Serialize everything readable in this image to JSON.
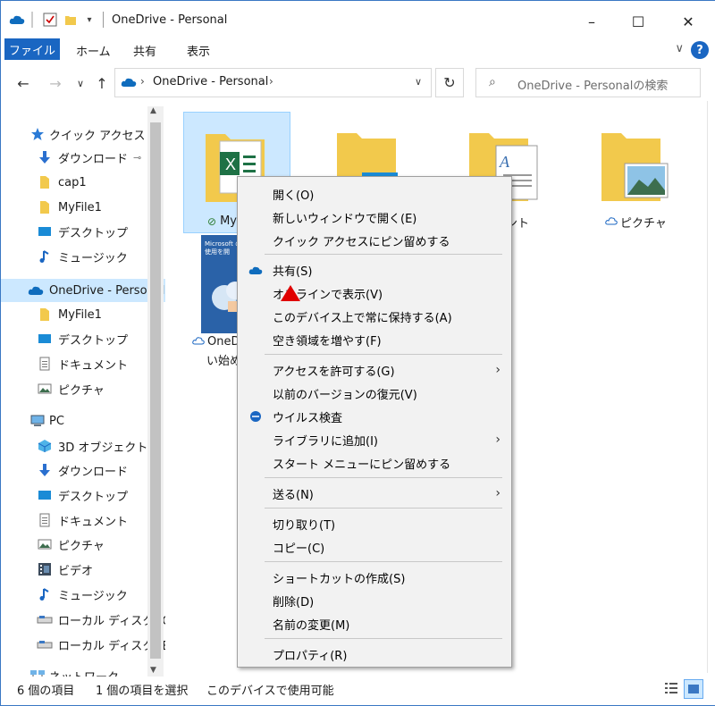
{
  "window": {
    "title": "OneDrive - Personal",
    "controls": {
      "minimize": "–",
      "maximize": "☐",
      "close": "✕"
    }
  },
  "ribbon": {
    "tabs": [
      "ファイル",
      "ホーム",
      "共有",
      "表示"
    ],
    "help": "?"
  },
  "address": {
    "path": "OneDrive - Personal",
    "search_placeholder": "OneDrive - Personalの検索"
  },
  "sidebar": {
    "items": [
      {
        "label": "クイック アクセス",
        "icon": "star-icon"
      },
      {
        "label": "ダウンロード",
        "icon": "download-icon"
      },
      {
        "label": "cap1",
        "icon": "folder-icon"
      },
      {
        "label": "MyFile1",
        "icon": "folder-icon"
      },
      {
        "label": "デスクトップ",
        "icon": "desktop-icon"
      },
      {
        "label": "ミュージック",
        "icon": "music-icon"
      },
      {
        "label": "OneDrive - Personal",
        "icon": "onedrive-icon"
      },
      {
        "label": "MyFile1",
        "icon": "folder-icon"
      },
      {
        "label": "デスクトップ",
        "icon": "desktop-icon"
      },
      {
        "label": "ドキュメント",
        "icon": "document-icon"
      },
      {
        "label": "ピクチャ",
        "icon": "pictures-icon"
      },
      {
        "label": "PC",
        "icon": "pc-icon"
      },
      {
        "label": "3D オブジェクト",
        "icon": "3d-objects-icon"
      },
      {
        "label": "ダウンロード",
        "icon": "download-icon"
      },
      {
        "label": "デスクトップ",
        "icon": "desktop-icon"
      },
      {
        "label": "ドキュメント",
        "icon": "document-icon"
      },
      {
        "label": "ピクチャ",
        "icon": "pictures-icon"
      },
      {
        "label": "ビデオ",
        "icon": "video-icon"
      },
      {
        "label": "ミュージック",
        "icon": "music-icon"
      },
      {
        "label": "ローカル ディスク (C",
        "icon": "drive-icon"
      },
      {
        "label": "ローカル ディスク (E",
        "icon": "drive-icon"
      },
      {
        "label": "ネットワーク",
        "icon": "network-icon"
      }
    ]
  },
  "content": {
    "items": [
      {
        "label": "My",
        "icon": "excel-folder-icon"
      },
      {
        "label": "",
        "icon": "desktop-folder-icon"
      },
      {
        "label": "メント",
        "icon": "documents-folder-icon"
      },
      {
        "label": "ピクチャ",
        "icon": "pictures-folder-icon"
      },
      {
        "label": "OneD",
        "label2": "い始め",
        "icon": "pdf-thumbnail-icon",
        "thumb_text": "Microsoft の使用を開"
      }
    ]
  },
  "context_menu": {
    "items": [
      "開く(O)",
      "新しいウィンドウで開く(E)",
      "クイック アクセスにピン留めする",
      "共有(S)",
      "オンラインで表示(V)",
      "このデバイス上で常に保持する(A)",
      "空き領域を増やす(F)",
      "アクセスを許可する(G)",
      "以前のバージョンの復元(V)",
      "ウイルス検査",
      "ライブラリに追加(I)",
      "スタート メニューにピン留めする",
      "送る(N)",
      "切り取り(T)",
      "コピー(C)",
      "ショートカットの作成(S)",
      "削除(D)",
      "名前の変更(M)",
      "プロパティ(R)"
    ]
  },
  "status": {
    "count": "6 個の項目",
    "selected": "1 個の項目を選択",
    "availability": "このデバイスで使用可能"
  },
  "colors": {
    "accent": "#1a66c2",
    "selection": "#cce8ff",
    "folder": "#f2c94c",
    "onedrive": "#0f6cbd",
    "cursor": "#e00000"
  }
}
